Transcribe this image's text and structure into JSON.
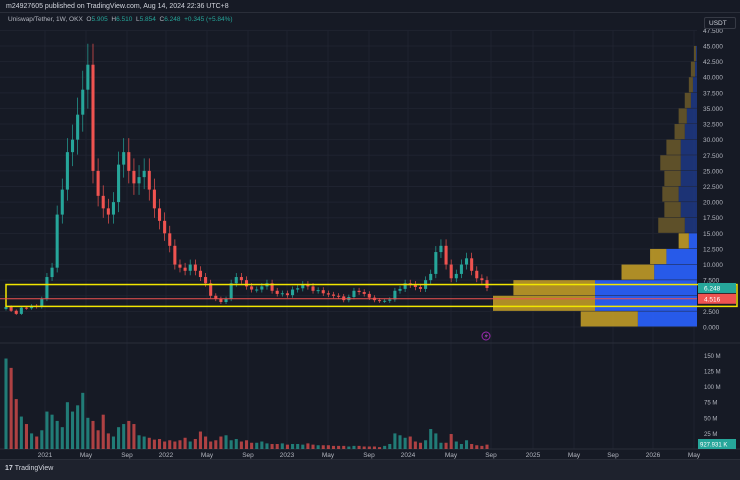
{
  "header": {
    "published": "m24927605 published on TradingView.com, Aug 14, 2024 22:36 UTC+8"
  },
  "legend": {
    "symbol": "Uniswap/Tether, 1W, OKX",
    "o_label": "O",
    "o": "5.905",
    "h_label": "H",
    "h": "6.510",
    "l_label": "L",
    "l": "5.854",
    "c_label": "C",
    "c": "6.248",
    "change": "+0.345 (+5.84%)"
  },
  "price_axis": {
    "unit": "USDT",
    "ticks": [
      "0.000",
      "2.500",
      "5.000",
      "7.500",
      "10.000",
      "12.500",
      "15.000",
      "17.500",
      "20.000",
      "22.500",
      "25.000",
      "27.500",
      "30.000",
      "32.500",
      "35.000",
      "37.500",
      "40.000",
      "42.500",
      "45.000",
      "47.500"
    ],
    "current_price": "6.248",
    "vp_poc_price": "4.516"
  },
  "volume_axis": {
    "ticks": [
      "25 M",
      "50 M",
      "75 M",
      "100 M",
      "125 M",
      "150 M"
    ],
    "current_volume": "927.931 K"
  },
  "time_axis": {
    "labels": [
      "2021",
      "May",
      "Sep",
      "2022",
      "May",
      "Sep",
      "2023",
      "May",
      "Sep",
      "2024",
      "May",
      "Sep",
      "2025",
      "May",
      "Sep",
      "2026",
      "May"
    ]
  },
  "footer": {
    "logo_mark": "17",
    "logo_text": "TradingView"
  },
  "colors": {
    "up": "#26a69a",
    "down": "#ef5350",
    "highlight": "#f2e600",
    "vp_up": "#2962ff",
    "vp_down": "#c9a227"
  },
  "chart_data": {
    "type": "candlestick",
    "closes": [
      3.2,
      2.6,
      2.1,
      3.1,
      3.0,
      3.4,
      3.2,
      4.5,
      8,
      9.5,
      18,
      22,
      28,
      30,
      34,
      38,
      42,
      25,
      21,
      19,
      18,
      20,
      26,
      28,
      25,
      23,
      24,
      25,
      22,
      19,
      17,
      15,
      13,
      10,
      9.5,
      9,
      10,
      9,
      8,
      7,
      5,
      4.5,
      4,
      4.5,
      7,
      8,
      7.5,
      6.5,
      6,
      6,
      6.5,
      7,
      5.8,
      5.3,
      5.4,
      5.1,
      6,
      6.2,
      6.8,
      6.5,
      5.8,
      5.9,
      5.4,
      5.2,
      5,
      4.9,
      4.3,
      4.8,
      5.8,
      5.6,
      5.3,
      4.7,
      4.3,
      4.2,
      4.2,
      4.4,
      5.8,
      6.1,
      7,
      6.8,
      6.4,
      6.1,
      7.5,
      8.5,
      12,
      13,
      10,
      7.8,
      8.5,
      10,
      11,
      9,
      7.8,
      7.5,
      6.248
    ],
    "volumes_m": [
      145,
      130,
      80,
      52,
      40,
      25,
      20,
      30,
      60,
      55,
      45,
      35,
      75,
      60,
      70,
      90,
      50,
      45,
      30,
      55,
      25,
      20,
      35,
      40,
      45,
      40,
      22,
      20,
      18,
      15,
      16,
      12,
      14,
      12,
      14,
      18,
      12,
      16,
      28,
      20,
      12,
      14,
      20,
      22,
      14,
      16,
      12,
      14,
      10,
      10,
      12,
      9,
      8,
      8,
      9,
      7,
      8,
      8,
      7,
      9,
      7,
      6,
      6,
      6,
      5,
      5,
      5,
      4,
      5,
      5,
      4,
      4,
      4,
      3,
      5,
      8,
      25,
      22,
      18,
      20,
      12,
      10,
      14,
      32,
      25,
      10,
      10,
      24,
      12,
      8,
      14,
      8,
      6,
      5,
      7
    ],
    "volume_profile": [
      {
        "low": 0,
        "high": 2.5,
        "up": 29,
        "down": 28
      },
      {
        "low": 2.5,
        "high": 5,
        "up": 50,
        "down": 50
      },
      {
        "low": 5,
        "high": 7.5,
        "up": 50,
        "down": 40
      },
      {
        "low": 7.5,
        "high": 10,
        "up": 21,
        "down": 16
      },
      {
        "low": 10,
        "high": 12.5,
        "up": 15,
        "down": 8
      },
      {
        "low": 12.5,
        "high": 15,
        "up": 4,
        "down": 5
      },
      {
        "low": 15,
        "high": 17.5,
        "up": 6,
        "down": 13
      },
      {
        "low": 17.5,
        "high": 20,
        "up": 8,
        "down": 8
      },
      {
        "low": 20,
        "high": 22.5,
        "up": 9,
        "down": 8
      },
      {
        "low": 22.5,
        "high": 25,
        "up": 8,
        "down": 8
      },
      {
        "low": 25,
        "high": 27.5,
        "up": 8,
        "down": 10
      },
      {
        "low": 27.5,
        "high": 30,
        "up": 8,
        "down": 7
      },
      {
        "low": 30,
        "high": 32.5,
        "up": 6,
        "down": 5
      },
      {
        "low": 32.5,
        "high": 35,
        "up": 5,
        "down": 4
      },
      {
        "low": 35,
        "high": 37.5,
        "up": 3,
        "down": 3
      },
      {
        "low": 37.5,
        "high": 40,
        "up": 2,
        "down": 2
      },
      {
        "low": 40,
        "high": 42.5,
        "up": 1,
        "down": 2
      },
      {
        "low": 42.5,
        "high": 45,
        "up": 0.5,
        "down": 1
      }
    ],
    "highlight_range": [
      3.3,
      6.8
    ],
    "ylim": [
      0,
      47.5
    ]
  }
}
